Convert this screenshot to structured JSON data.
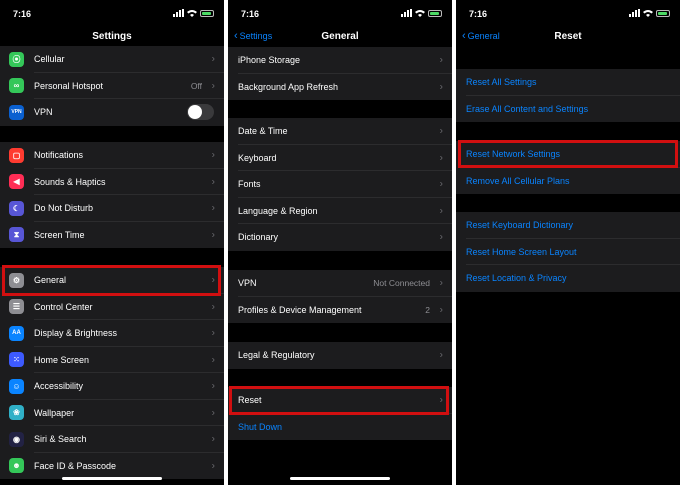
{
  "status": {
    "time": "7:16"
  },
  "panel1": {
    "title": "Settings",
    "rows_top": [
      {
        "label": "Cellular",
        "icon": "cellular-icon",
        "color": "#34c759",
        "glyph": "((·))"
      },
      {
        "label": "Personal Hotspot",
        "value": "Off",
        "icon": "hotspot-icon",
        "color": "#34c759",
        "glyph": "∞"
      },
      {
        "label": "VPN",
        "icon": "vpn-icon",
        "color": "#0a60d0",
        "glyph": "VPN",
        "toggle": "off"
      }
    ],
    "rows_mid": [
      {
        "label": "Notifications",
        "icon": "notifications-icon",
        "color": "#ff3b30",
        "glyph": "▢"
      },
      {
        "label": "Sounds & Haptics",
        "icon": "sounds-icon",
        "color": "#ff2d55",
        "glyph": "◀"
      },
      {
        "label": "Do Not Disturb",
        "icon": "moon-icon",
        "color": "#5856d6",
        "glyph": "☾"
      },
      {
        "label": "Screen Time",
        "icon": "hourglass-icon",
        "color": "#5856d6",
        "glyph": "⧗"
      }
    ],
    "rows_bottom": [
      {
        "label": "General",
        "icon": "gear-icon",
        "color": "#8e8e93",
        "glyph": "⚙"
      },
      {
        "label": "Control Center",
        "icon": "control-center-icon",
        "color": "#8e8e93",
        "glyph": "☰"
      },
      {
        "label": "Display & Brightness",
        "icon": "display-icon",
        "color": "#0a84ff",
        "glyph": "AA"
      },
      {
        "label": "Home Screen",
        "icon": "home-screen-icon",
        "color": "#3d5afe",
        "glyph": "⁙"
      },
      {
        "label": "Accessibility",
        "icon": "accessibility-icon",
        "color": "#0a84ff",
        "glyph": "☺"
      },
      {
        "label": "Wallpaper",
        "icon": "wallpaper-icon",
        "color": "#30b0c7",
        "glyph": "❀"
      },
      {
        "label": "Siri & Search",
        "icon": "siri-icon",
        "color": "#222244",
        "glyph": "◉"
      },
      {
        "label": "Face ID & Passcode",
        "icon": "faceid-icon",
        "color": "#34c759",
        "glyph": "☻"
      }
    ]
  },
  "panel2": {
    "back": "Settings",
    "title": "General",
    "group1": [
      {
        "label": "iPhone Storage"
      },
      {
        "label": "Background App Refresh"
      }
    ],
    "group2": [
      {
        "label": "Date & Time"
      },
      {
        "label": "Keyboard"
      },
      {
        "label": "Fonts"
      },
      {
        "label": "Language & Region"
      },
      {
        "label": "Dictionary"
      }
    ],
    "group3": [
      {
        "label": "VPN",
        "value": "Not Connected"
      },
      {
        "label": "Profiles & Device Management",
        "value": "2"
      }
    ],
    "group4": [
      {
        "label": "Legal & Regulatory"
      }
    ],
    "group5": [
      {
        "label": "Reset"
      },
      {
        "label": "Shut Down"
      }
    ]
  },
  "panel3": {
    "back": "General",
    "title": "Reset",
    "group1": [
      {
        "label": "Reset All Settings"
      },
      {
        "label": "Erase All Content and Settings"
      }
    ],
    "group2": [
      {
        "label": "Reset Network Settings"
      },
      {
        "label": "Remove All Cellular Plans"
      }
    ],
    "group3": [
      {
        "label": "Reset Keyboard Dictionary"
      },
      {
        "label": "Reset Home Screen Layout"
      },
      {
        "label": "Reset Location & Privacy"
      }
    ]
  },
  "colors": {
    "highlight": "#d10f10",
    "link": "#0a84ff",
    "cell": "#1c1c1e",
    "background": "#000000"
  }
}
